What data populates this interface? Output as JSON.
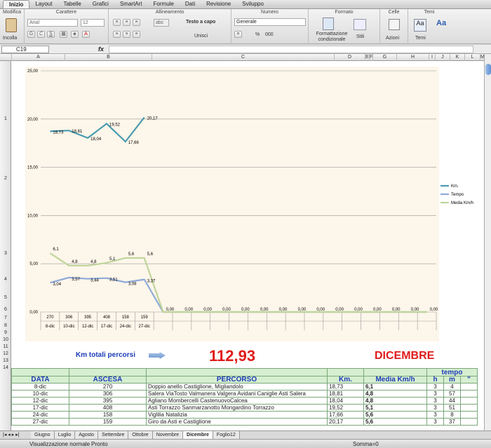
{
  "ribbon_tabs": [
    "Inizio",
    "Layout",
    "Tabelle",
    "Grafici",
    "SmartArt",
    "Formule",
    "Dati",
    "Revisione",
    "Sviluppo"
  ],
  "ribbon": {
    "groups": [
      "Modifica",
      "Carattere",
      "Allineamento",
      "Numero",
      "Formato",
      "Celle",
      "Temi"
    ],
    "paste_label": "Incolla",
    "font_name": "Arial",
    "font_size": "12",
    "wrap_label": "Testo a capo",
    "merge_label": "Unisci",
    "number_format": "Generale",
    "cond_format_label": "Formattazione condizionale",
    "styles_label": "Stili",
    "actions_label": "Azioni",
    "themes_label": "Temi",
    "abc_label": "abc",
    "percent_label": "%",
    "thousands_label": "000"
  },
  "formula_bar": {
    "cell": "C19",
    "fx": "fx",
    "value": ""
  },
  "columns": [
    "A",
    "B",
    "C",
    "D",
    "E",
    "F",
    "G",
    "H",
    "I",
    "J",
    "K",
    "L",
    "M"
  ],
  "rows": [
    "1",
    "2",
    "3",
    "4",
    "5",
    "6",
    "7",
    "8",
    "9",
    "10",
    "11",
    "12",
    "13",
    "14"
  ],
  "chart_data": {
    "type": "line",
    "categories": [
      "270\n8-dic",
      "306\n10-dic",
      "395\n12-dic",
      "408\n17-dic",
      "158\n24-dic",
      "159\n27-dic",
      "",
      "",
      "",
      "",
      "",
      "",
      "",
      "",
      "",
      "",
      "",
      "",
      "",
      "",
      ""
    ],
    "category_top": [
      "270",
      "306",
      "395",
      "408",
      "158",
      "159",
      "",
      "",
      "",
      "",
      "",
      "",
      "",
      "",
      "",
      "",
      "",
      "",
      "",
      "",
      ""
    ],
    "category_bottom": [
      "8-dic",
      "10-dic",
      "12-dic",
      "17-dic",
      "24-dic",
      "27-dic",
      "",
      "",
      "",
      "",
      "",
      "",
      "",
      "",
      "",
      "",
      "",
      "",
      "",
      "",
      ""
    ],
    "yticks": [
      "0,00",
      "5,00",
      "10,00",
      "15,00",
      "20,00",
      "25,00"
    ],
    "ylim": [
      0,
      25
    ],
    "series": [
      {
        "name": "Km.",
        "color": "#4a9bb0",
        "values": [
          18.73,
          18.81,
          18.04,
          19.52,
          17.66,
          20.17
        ],
        "labels": [
          "18,73",
          "18,81",
          "18,04",
          "19,52",
          "17,66",
          "20,17"
        ]
      },
      {
        "name": "Tempo",
        "color": "#8faad9",
        "values": [
          3.04,
          3.57,
          3.44,
          3.51,
          3.08,
          3.37,
          0,
          0,
          0,
          0,
          0,
          0,
          0,
          0,
          0,
          0,
          0,
          0,
          0,
          0,
          0
        ],
        "labels": [
          "3,04",
          "3,57",
          "3,44",
          "3,51",
          "3,08",
          "3,37",
          "0,00",
          "0,00",
          "0,00",
          "0,00",
          "0,00",
          "0,00",
          "0,00",
          "0,00",
          "0,00",
          "0,00",
          "0,00",
          "0,00",
          "0,00",
          "0,00",
          "0,00"
        ]
      },
      {
        "name": "Media Km/h",
        "color": "#bfd59a",
        "values": [
          6.1,
          4.8,
          4.8,
          5.1,
          5.6,
          5.6,
          0,
          0,
          0,
          0,
          0,
          0,
          0,
          0,
          0,
          0,
          0,
          0,
          0,
          0,
          0
        ],
        "labels": [
          "6,1",
          "4,8",
          "4,8",
          "5,1",
          "5,6",
          "5,6",
          "",
          "",
          "",
          "",
          "",
          "",
          "",
          "",
          "",
          "",
          "",
          "",
          "",
          "",
          ""
        ]
      }
    ],
    "legend": "right"
  },
  "summary": {
    "km_label": "Km totali percorsi",
    "km_total": "112,93",
    "month": "DICEMBRE"
  },
  "table": {
    "headers": [
      "DATA",
      "ASCESA",
      "PERCORSO",
      "Km.",
      "Media Km/h",
      "tempo"
    ],
    "sub_headers": [
      "h",
      "m",
      "\""
    ],
    "rows": [
      {
        "data": "8-dic",
        "ascesa": "270",
        "percorso": "Doppio anello Castiglione, Migliandolo",
        "km": "18,73",
        "media": "6,1",
        "h": "3",
        "m": "4"
      },
      {
        "data": "10-dic",
        "ascesa": "306",
        "percorso": "Salera ViaTosto Valmanera Valgera Avidani Caniglie Asti Salera",
        "km": "18,81",
        "media": "4,8",
        "h": "3",
        "m": "57"
      },
      {
        "data": "12-dic",
        "ascesa": "395",
        "percorso": "Agliano Mombercelli CastenuovoCalcea",
        "km": "18,04",
        "media": "4,8",
        "h": "3",
        "m": "44"
      },
      {
        "data": "17-dic",
        "ascesa": "408",
        "percorso": "Asti Torrazzo Sanmarzanotto Mongardino Torrazzo",
        "km": "19,52",
        "media": "5,1",
        "h": "3",
        "m": "51"
      },
      {
        "data": "24-dic",
        "ascesa": "158",
        "percorso": "Viglilia Natalizia",
        "km": "17,66",
        "media": "5,6",
        "h": "3",
        "m": "8"
      },
      {
        "data": "27-dic",
        "ascesa": "159",
        "percorso": "Giro da Asti e Castiglione",
        "km": "20,17",
        "media": "5,6",
        "h": "3",
        "m": "37"
      }
    ]
  },
  "sheet_tabs": [
    "Giugno",
    "Luglio",
    "Agosto",
    "Settembre",
    "Ottobre",
    "Novembre",
    "Dicembre",
    "Foglio12"
  ],
  "active_sheet": "Dicembre",
  "status": {
    "view": "Visualizzazione normale",
    "state": "Pronto",
    "sum": "Somma=0"
  }
}
